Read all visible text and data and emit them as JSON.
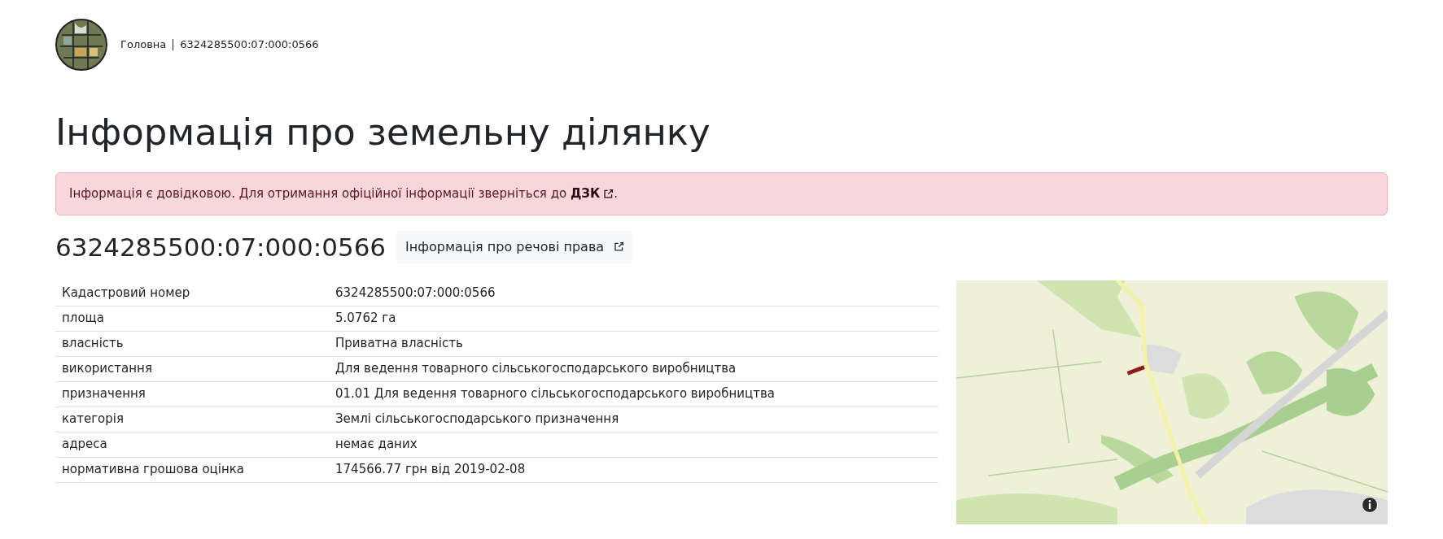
{
  "breadcrumb": [
    {
      "label": "Головна"
    },
    {
      "label": "6324285500:07:000:0566"
    }
  ],
  "title": "Інформація про земельну ділянку",
  "alert": {
    "text": "Інформація є довідковою. Для отримання офіційної інформації зверніться до",
    "link": "ДЗК",
    "end": "."
  },
  "cadastral_number": "6324285500:07:000:0566",
  "rights_button": "Інформація про речові права",
  "table": {
    "rows": [
      {
        "label": "Кадастровий номер",
        "value": "6324285500:07:000:0566"
      },
      {
        "label": "площа",
        "value": "5.0762 га"
      },
      {
        "label": "власність",
        "value": "Приватна власність"
      },
      {
        "label": "використання",
        "value": "Для ведення товарного сільськогосподарського виробництва"
      },
      {
        "label": "призначення",
        "value": "01.01 Для ведення товарного сільськогосподарського виробництва"
      },
      {
        "label": "категорія",
        "value": "Землі сільськогосподарського призначення"
      },
      {
        "label": "адреса",
        "value": "немає даних"
      },
      {
        "label": "нормативна грошова оцінка",
        "value": "174566.77 грн від 2019-02-08"
      }
    ]
  }
}
